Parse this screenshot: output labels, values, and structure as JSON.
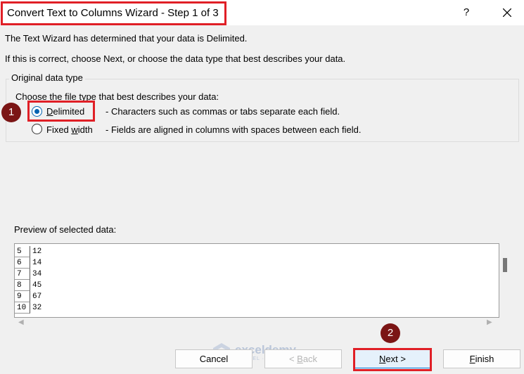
{
  "window": {
    "title": "Convert Text to Columns Wizard - Step 1 of 3",
    "help_label": "?"
  },
  "intro": {
    "line1": "The Text Wizard has determined that your data is Delimited.",
    "line2": "If this is correct, choose Next, or choose the data type that best describes your data."
  },
  "original_data_type": {
    "legend": "Original data type",
    "prompt": "Choose the file type that best describes your data:",
    "options": [
      {
        "label_pre": "",
        "label_u": "D",
        "label_post": "elimited",
        "description": "- Characters such as commas or tabs separate each field.",
        "checked": true
      },
      {
        "label_pre": "Fixed ",
        "label_u": "w",
        "label_post": "idth",
        "description": "- Fields are aligned in columns with spaces between each field.",
        "checked": false
      }
    ]
  },
  "preview": {
    "label": "Preview of selected data:",
    "rows": [
      {
        "num": "5",
        "value": "12"
      },
      {
        "num": "6",
        "value": "14"
      },
      {
        "num": "7",
        "value": "34"
      },
      {
        "num": "8",
        "value": "45"
      },
      {
        "num": "9",
        "value": "67"
      },
      {
        "num": "10",
        "value": "32"
      }
    ]
  },
  "buttons": {
    "cancel": "Cancel",
    "back_pre": "< ",
    "back_u": "B",
    "back_post": "ack",
    "next_u": "N",
    "next_post": "ext >",
    "finish_u": "F",
    "finish_post": "inish"
  },
  "annotations": {
    "step1": "1",
    "step2": "2"
  },
  "watermark": {
    "name": "exceldemy",
    "tagline": "EXCEL · DATA · BI"
  },
  "colors": {
    "highlight": "#e01f26",
    "badge": "#7b1515",
    "accent": "#0078d7"
  }
}
